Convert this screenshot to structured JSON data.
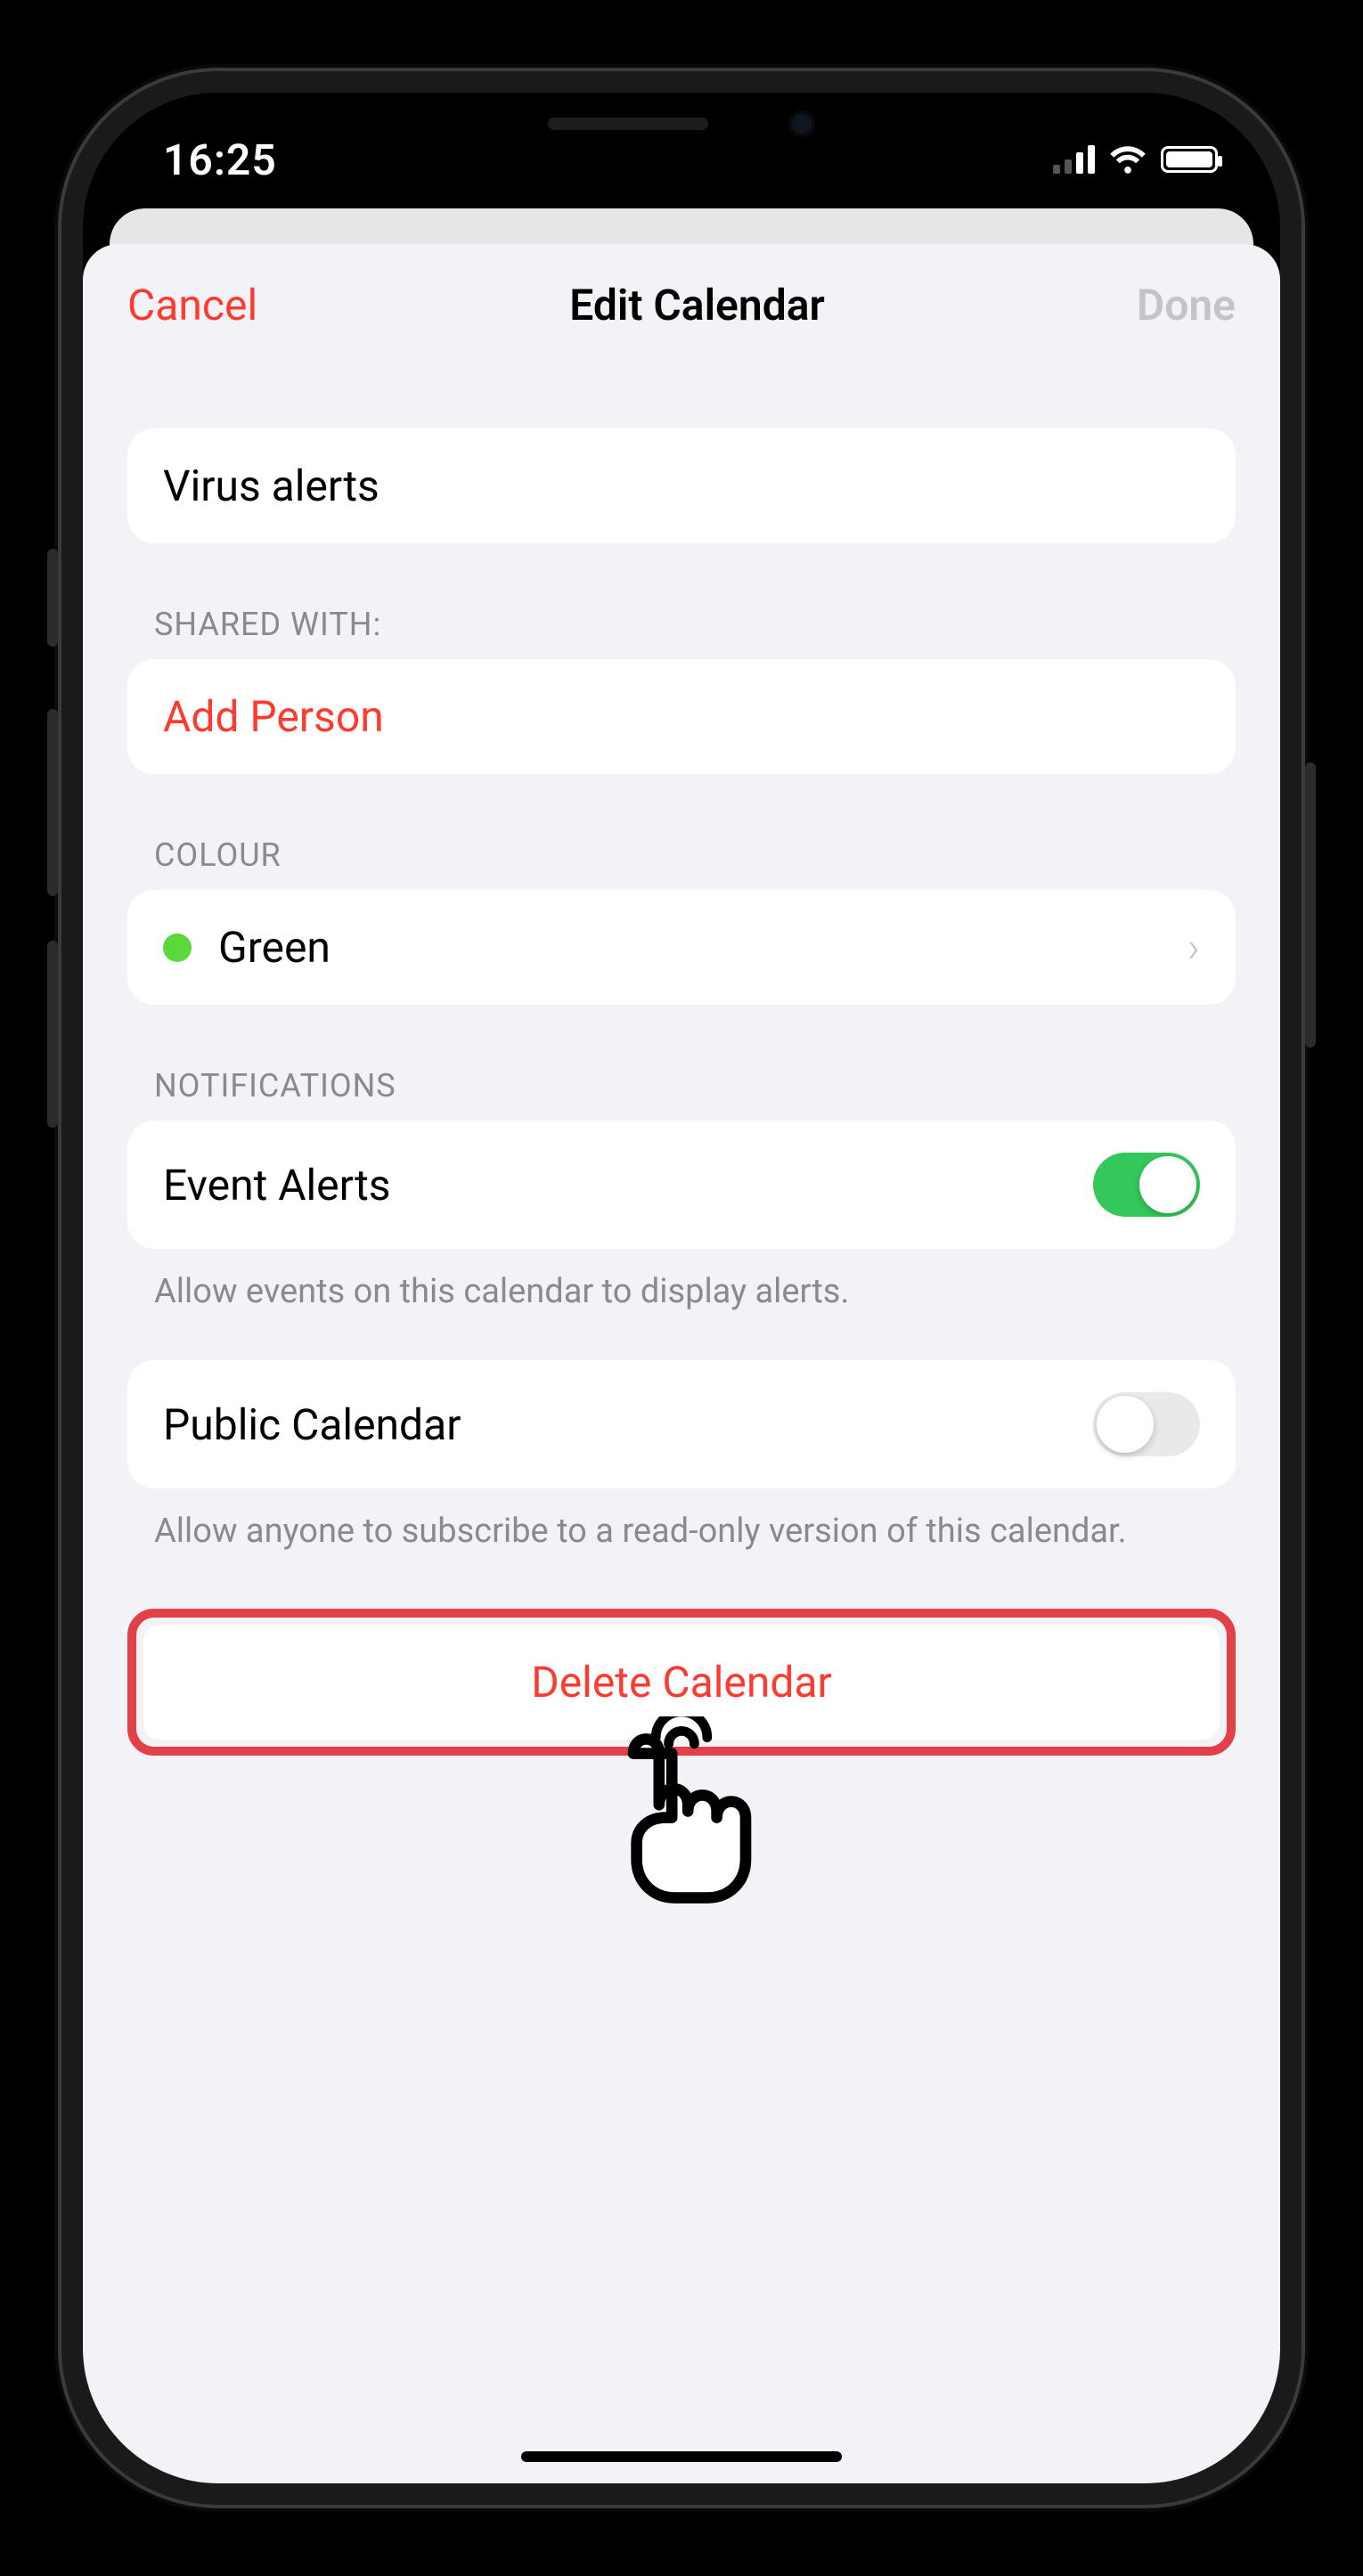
{
  "status": {
    "time": "16:25"
  },
  "nav": {
    "cancel": "Cancel",
    "title": "Edit Calendar",
    "done": "Done"
  },
  "calendar": {
    "name": "Virus alerts"
  },
  "shared": {
    "header": "SHARED WITH:",
    "add_person": "Add Person"
  },
  "colour": {
    "header": "COLOUR",
    "name": "Green",
    "hex": "#5bd83b"
  },
  "notifications": {
    "header": "NOTIFICATIONS",
    "event_alerts_label": "Event Alerts",
    "event_alerts_on": true,
    "event_alerts_footer": "Allow events on this calendar to display alerts.",
    "public_label": "Public Calendar",
    "public_on": false,
    "public_footer": "Allow anyone to subscribe to a read-only version of this calendar."
  },
  "delete": {
    "label": "Delete Calendar"
  }
}
